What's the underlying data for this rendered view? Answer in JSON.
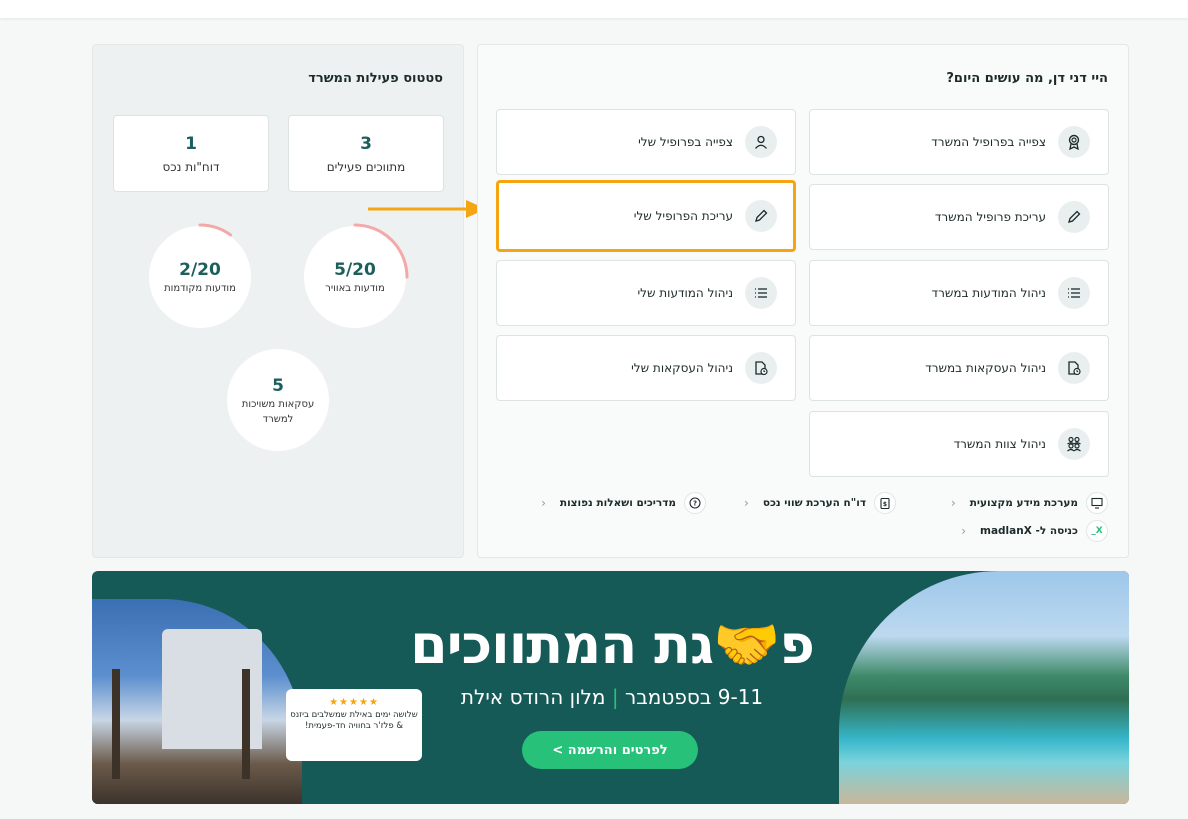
{
  "status": {
    "title": "סטטוס פעילות המשרד",
    "cards": [
      {
        "value": "3",
        "label": "מתווכים פעילים"
      },
      {
        "value": "1",
        "label": "דוח\"ות נכס"
      }
    ],
    "circles": [
      {
        "value": "5/20",
        "label": "מודעות באוויר",
        "progress": 0.25
      },
      {
        "value": "2/20",
        "label": "מודעות מקודמות",
        "progress": 0.1
      },
      {
        "value": "5",
        "label": "עסקאות משויכות למשרד"
      }
    ]
  },
  "actions": {
    "title": "היי דני דן, מה עושים היום?",
    "office": [
      {
        "label": "צפייה בפרופיל המשרד",
        "icon": "award-icon"
      },
      {
        "label": "עריכת פרופיל המשרד",
        "icon": "pencil-icon"
      },
      {
        "label": "ניהול המודעות במשרד",
        "icon": "list-icon"
      },
      {
        "label": "ניהול העסקאות במשרד",
        "icon": "document-clock-icon"
      },
      {
        "label": "ניהול צוות המשרד",
        "icon": "team-icon"
      }
    ],
    "personal": [
      {
        "label": "צפייה בפרופיל שלי",
        "icon": "user-icon"
      },
      {
        "label": "עריכת הפרופיל שלי",
        "icon": "pencil-icon"
      },
      {
        "label": "ניהול המודעות שלי",
        "icon": "list-icon"
      },
      {
        "label": "ניהול העסקאות שלי",
        "icon": "document-clock-icon"
      }
    ],
    "links": [
      {
        "label": "מערכת מידע מקצועית",
        "icon": "monitor-icon"
      },
      {
        "label": "דו\"ח הערכת שווי נכס",
        "icon": "clipboard-dollar-icon"
      },
      {
        "label": "מדריכים ושאלות נפוצות",
        "icon": "question-icon"
      },
      {
        "label": "כניסה ל- madlanX",
        "icon": "madlanx-logo",
        "icon_text": "X_"
      }
    ]
  },
  "banner": {
    "headline": "פ🤝גת המתווכים",
    "subtitle_dates": "9-11 בספטמבר",
    "subtitle_separator": "|",
    "subtitle_place": "מלון הרודס אילת",
    "cta": "לפרטים והרשמה >",
    "bubble_stars": "★★★★★",
    "bubble_text": "שלושה ימים באילת שמשלבים ביזנס & פלז'ר בחוויה חד-פעמית!"
  },
  "colors": {
    "accent": "#1c5f5b",
    "highlight": "#f5a511",
    "banner_bg": "#165a58",
    "cta": "#27c17a",
    "progress": "#f4a9a8"
  }
}
